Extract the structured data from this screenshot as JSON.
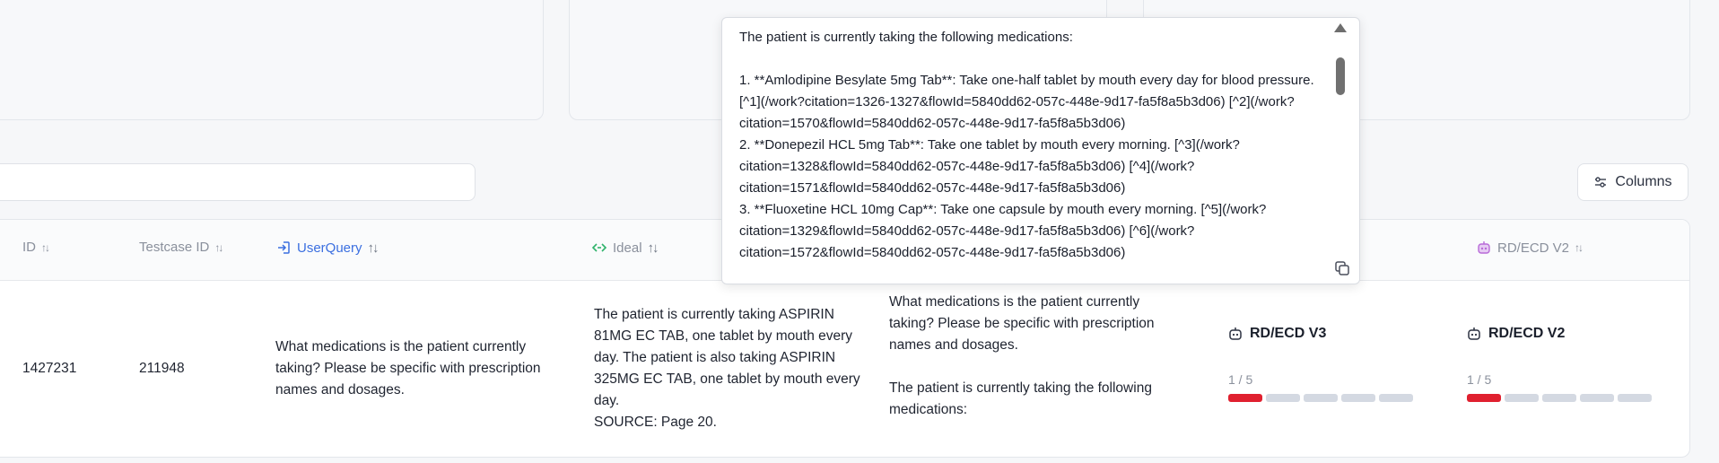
{
  "toolbar": {
    "columns_label": "Columns"
  },
  "table": {
    "headers": {
      "id": "ID",
      "testcase_id": "Testcase ID",
      "user_query": "UserQuery",
      "ideal": "Ideal",
      "rd_ecd_v2": "RD/ECD V2"
    },
    "row": {
      "id": "1427231",
      "testcase_id": "211948",
      "user_query": "What medications is the patient currently taking? Please be specific with prescription names and dosages.",
      "ideal": "The patient is currently taking ASPIRIN 81MG EC TAB, one tablet by mouth every day.  The patient is also taking ASPIRIN 325MG EC TAB, one tablet by mouth every day.\nSOURCE: Page 20.",
      "response": "What medications is the patient currently taking? Please be specific with prescription names and dosages.\n\nThe patient is currently taking the following medications:",
      "models": [
        {
          "name": "RD/ECD V3",
          "score": "1 / 5",
          "score_value": 1,
          "score_max": 5
        },
        {
          "name": "RD/ECD V2",
          "score": "1 / 5",
          "score_value": 1,
          "score_max": 5
        }
      ]
    }
  },
  "popover": {
    "lines": [
      "The patient is currently taking the following medications:",
      "",
      "1. **Amlodipine Besylate 5mg Tab**: Take one-half tablet by mouth every day for blood pressure. [^1](/work?citation=1326-1327&flowId=5840dd62-057c-448e-9d17-fa5f8a5b3d06) [^2](/work?citation=1570&flowId=5840dd62-057c-448e-9d17-fa5f8a5b3d06)",
      "2. **Donepezil HCL 5mg Tab**: Take one tablet by mouth every morning. [^3](/work?citation=1328&flowId=5840dd62-057c-448e-9d17-fa5f8a5b3d06) [^4](/work?citation=1571&flowId=5840dd62-057c-448e-9d17-fa5f8a5b3d06)",
      "3. **Fluoxetine HCL 10mg Cap**: Take one capsule by mouth every morning. [^5](/work?citation=1329&flowId=5840dd62-057c-448e-9d17-fa5f8a5b3d06) [^6](/work?citation=1572&flowId=5840dd62-057c-448e-9d17-fa5f8a5b3d06)"
    ]
  },
  "colors": {
    "score_filled": "#e0202f",
    "score_empty": "#d4d9e2",
    "user_query_icon": "#3b6fe0",
    "ideal_icon": "#2fb36b",
    "model_icon": "#b86ad8"
  },
  "icons": {
    "user_query": "login-icon",
    "ideal": "code-arrows-icon",
    "model": "robot-icon",
    "columns": "sliders-icon",
    "copy": "copy-icon"
  }
}
